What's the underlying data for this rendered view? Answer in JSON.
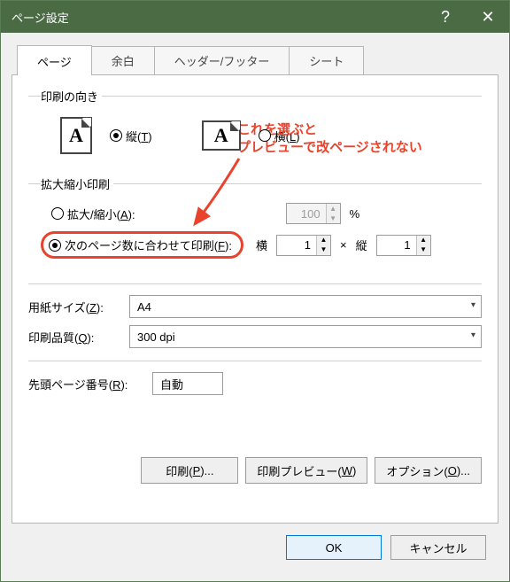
{
  "title": "ページ設定",
  "tabs": {
    "page": "ページ",
    "margin": "余白",
    "hf": "ヘッダー/フッター",
    "sheet": "シート"
  },
  "orient": {
    "legend": "印刷の向き",
    "portrait_label": "縦(",
    "portrait_key": "T",
    "landscape_label": "横(",
    "landscape_key": "L",
    "close": ")"
  },
  "scale": {
    "legend": "拡大縮小印刷",
    "adjust_label": "拡大/縮小(",
    "adjust_key": "A",
    "adjust_close": "):",
    "adjust_value": "100",
    "percent": "%",
    "fit_label": "次のページ数に合わせて印刷(",
    "fit_key": "F",
    "fit_close": "):",
    "wide_label": "横",
    "wide_value": "1",
    "times": "×",
    "tall_label": "縦",
    "tall_value": "1"
  },
  "paper": {
    "label": "用紙サイズ(",
    "key": "Z",
    "close": "):",
    "value": "A4"
  },
  "qual": {
    "label": "印刷品質(",
    "key": "Q",
    "close": "):",
    "value": "300 dpi"
  },
  "first": {
    "label": "先頭ページ番号(",
    "key": "R",
    "close": "):",
    "value": "自動"
  },
  "buttons": {
    "print": "印刷(",
    "print_key": "P",
    "print_close": ")...",
    "preview": "印刷プレビュー(",
    "preview_key": "W",
    "preview_close": ")",
    "options": "オプション(",
    "options_key": "O",
    "options_close": ")..."
  },
  "footer": {
    "ok": "OK",
    "cancel": "キャンセル"
  },
  "annot": {
    "l1": "これを選ぶと",
    "l2": "プレビューで改ページされない"
  }
}
